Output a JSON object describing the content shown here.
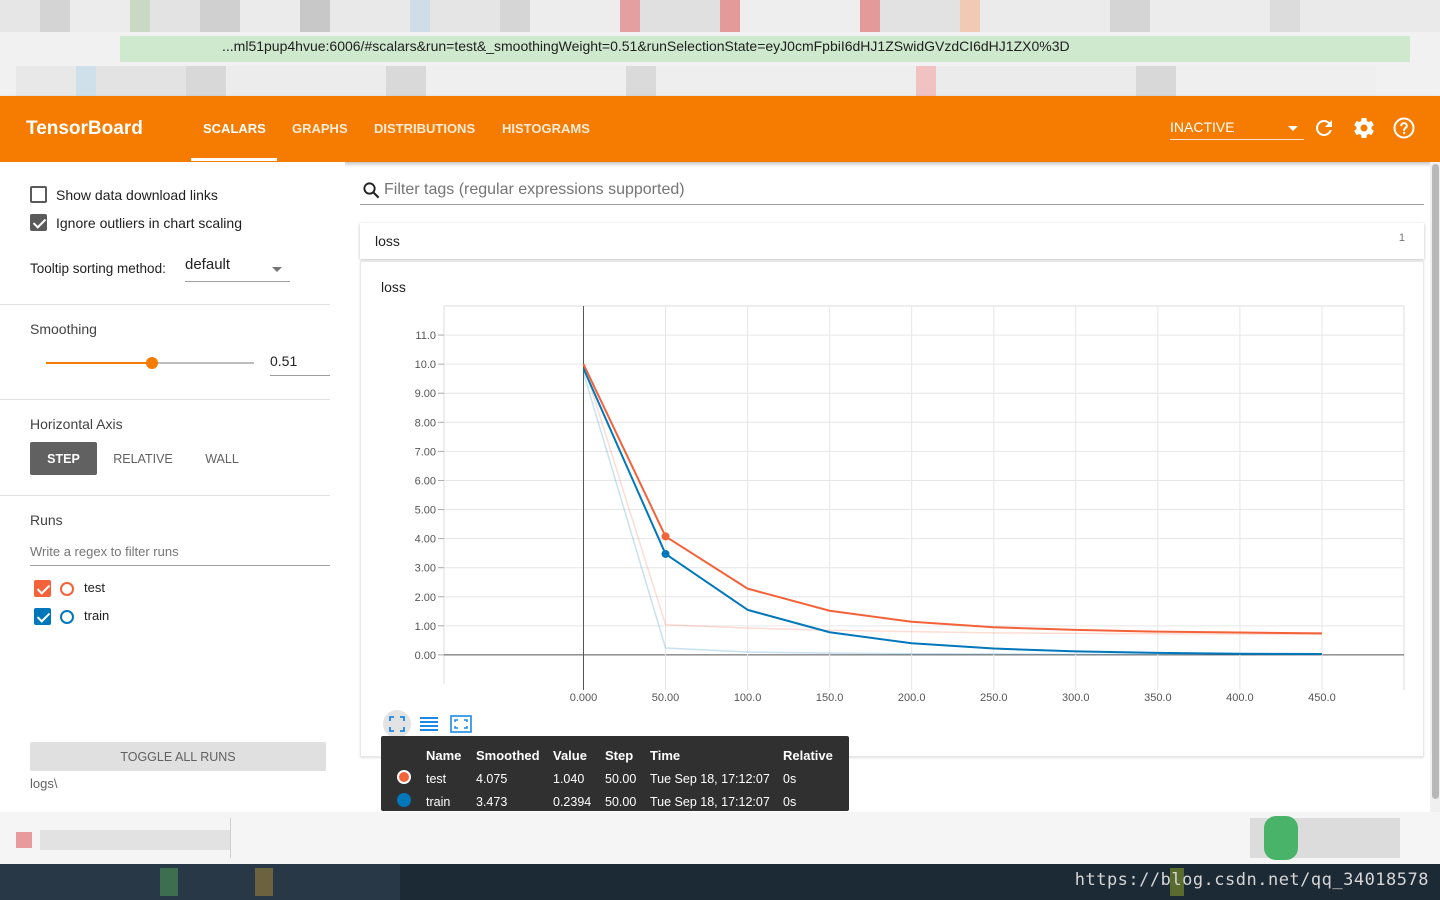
{
  "browser": {
    "url": "...ml51pup4hvue:6006/#scalars&run=test&_smoothingWeight=0.51&runSelectionState=eyJ0cmFpbiI6dHJ1ZSwidGVzdCI6dHJ1ZX0%3D",
    "icons": [
      "redacted-tab-blocks"
    ]
  },
  "header": {
    "brand": "TensorBoard",
    "tabs": [
      "SCALARS",
      "GRAPHS",
      "DISTRIBUTIONS",
      "HISTOGRAMS"
    ],
    "active_tab": "SCALARS",
    "status_select": "INACTIVE",
    "icons": [
      "refresh-icon",
      "settings-gear-icon",
      "help-icon"
    ],
    "accent": "#f57c00"
  },
  "sidebar": {
    "show_download_links": "Show data download links",
    "ignore_outliers": "Ignore outliers in chart scaling",
    "tooltip_sort_label": "Tooltip sorting method:",
    "tooltip_sort_value": "default",
    "smoothing_title": "Smoothing",
    "smoothing_value": "0.51",
    "smoothing_fraction": 0.51,
    "horizontal_axis_title": "Horizontal Axis",
    "axis_buttons": [
      "STEP",
      "RELATIVE",
      "WALL"
    ],
    "axis_active": "STEP",
    "runs_title": "Runs",
    "runs_filter_placeholder": "Write a regex to filter runs",
    "runs": [
      {
        "name": "test",
        "color": "#f4623a"
      },
      {
        "name": "train",
        "color": "#0077bb"
      }
    ],
    "toggle_all": "TOGGLE ALL RUNS",
    "logdir": "logs\\"
  },
  "main": {
    "filter_placeholder": "Filter tags (regular expressions supported)",
    "category": "loss",
    "category_count": "1",
    "chart_title": "loss"
  },
  "chart_data": {
    "type": "line",
    "title": "loss",
    "xlabel": "",
    "ylabel": "",
    "x_ticks": [
      "0.000",
      "50.00",
      "100.0",
      "150.0",
      "200.0",
      "250.0",
      "300.0",
      "350.0",
      "400.0",
      "450.0"
    ],
    "y_ticks": [
      "0.00",
      "1.00",
      "2.00",
      "3.00",
      "4.00",
      "5.00",
      "6.00",
      "7.00",
      "8.00",
      "9.00",
      "10.0",
      "11.0"
    ],
    "xlim": [
      -85,
      500
    ],
    "ylim": [
      -1.0,
      12.0
    ],
    "grid": true,
    "series": [
      {
        "name": "test",
        "color": "#f4623a",
        "smoothed": true,
        "x": [
          0,
          50,
          100,
          150,
          200,
          250,
          300,
          350,
          400,
          450
        ],
        "y": [
          10.0,
          4.075,
          2.28,
          1.52,
          1.14,
          0.95,
          0.86,
          0.8,
          0.77,
          0.74
        ]
      },
      {
        "name": "test",
        "color": "#f4623a",
        "smoothed": false,
        "x": [
          0,
          50,
          100,
          150,
          200,
          250,
          300,
          350,
          400,
          450
        ],
        "y": [
          10.0,
          1.04,
          0.92,
          0.85,
          0.8,
          0.76,
          0.74,
          0.73,
          0.72,
          0.71
        ]
      },
      {
        "name": "train",
        "color": "#0077bb",
        "smoothed": true,
        "x": [
          0,
          50,
          100,
          150,
          200,
          250,
          300,
          350,
          400,
          450
        ],
        "y": [
          9.85,
          3.473,
          1.55,
          0.78,
          0.4,
          0.22,
          0.12,
          0.07,
          0.04,
          0.03
        ]
      },
      {
        "name": "train",
        "color": "#0077bb",
        "smoothed": false,
        "x": [
          0,
          50,
          100,
          150,
          200,
          250,
          300,
          350,
          400,
          450
        ],
        "y": [
          9.7,
          0.2394,
          0.1,
          0.06,
          0.04,
          0.03,
          0.02,
          0.02,
          0.02,
          0.02
        ]
      }
    ],
    "highlight_x": 50
  },
  "tooltip": {
    "headers": [
      "Name",
      "Smoothed",
      "Value",
      "Step",
      "Time",
      "Relative"
    ],
    "rows": [
      {
        "color": "#f4623a",
        "name": "test",
        "smoothed": "4.075",
        "value": "1.040",
        "step": "50.00",
        "time": "Tue Sep 18, 17:12:07",
        "relative": "0s"
      },
      {
        "color": "#0077bb",
        "name": "train",
        "smoothed": "3.473",
        "value": "0.2394",
        "step": "50.00",
        "time": "Tue Sep 18, 17:12:07",
        "relative": "0s"
      }
    ]
  },
  "watermark": "https://blog.csdn.net/qq_34018578"
}
